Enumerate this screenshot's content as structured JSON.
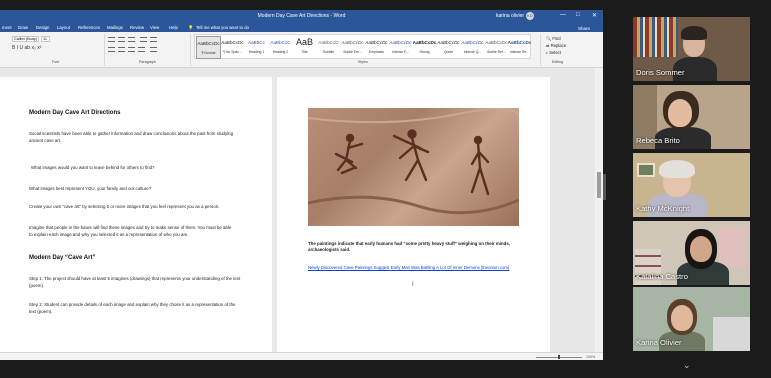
{
  "word": {
    "title": "Modern Day Cave Art Directions - Word",
    "user": "karina olivier",
    "user_initials": "KO",
    "window_controls": [
      "—",
      "□",
      "✕"
    ],
    "menu_tabs": [
      "ment",
      "Draw",
      "Design",
      "Layout",
      "References",
      "Mailings",
      "Review",
      "View",
      "Help"
    ],
    "tell_me": "Tell me what you want to do",
    "share": "Share",
    "font_name": "Calibri (Body)",
    "font_size": "11",
    "format_row": "B  I  U  ab  x₂  x²",
    "groups": {
      "font": "Font",
      "paragraph": "Paragraph",
      "styles": "Styles",
      "editing": "Editing"
    },
    "styles": [
      {
        "preview": "AaBbCcDc",
        "name": "¶ Normal"
      },
      {
        "preview": "AaBbCcDc",
        "name": "¶ No Spac..."
      },
      {
        "preview": "AaBbCc",
        "name": "Heading 1"
      },
      {
        "preview": "AaBbCcC",
        "name": "Heading 2"
      },
      {
        "preview": "AaB",
        "name": "Title"
      },
      {
        "preview": "AaBbCcD",
        "name": "Subtitle"
      },
      {
        "preview": "AaBbCcDc",
        "name": "Subtle Em..."
      },
      {
        "preview": "AaBbCcDc",
        "name": "Emphasis"
      },
      {
        "preview": "AaBbCcDc",
        "name": "Intense E..."
      },
      {
        "preview": "AaBbCcDc",
        "name": "Strong"
      },
      {
        "preview": "AaBbCcDc",
        "name": "Quote"
      },
      {
        "preview": "AaBbCcDc",
        "name": "Intense Q..."
      },
      {
        "preview": "AaBbCcDc",
        "name": "Subtle Ref..."
      },
      {
        "preview": "AaBbCcDc",
        "name": "Intense Re..."
      }
    ],
    "editing": [
      "Find",
      "Replace",
      "Select"
    ],
    "page1": {
      "heading1": "Modern Day Cave Art Directions",
      "p1": "Social scientists have been able to gather information and draw conclusions about the past from studying ancient cave art.",
      "p2": "What images would you want to leave behind for others to find?",
      "p3": "What images best represent YOU, your family and our culture?",
      "p4": "Create your own “cave art” by selecting 5 or more images that you feel represent you as a person.",
      "p5": "Imagine that people in the future will find these images and try to make sense of them. You must be able to explain each image and why you selected it as a representation of who you are.",
      "heading2": "Modern Day “Cave Art”",
      "p6": "Step 1: The project should have at least 5 imagines (drawings) that represents your understanding of the text (poem).",
      "p7": "Step 2: Student can provide details of each image and explain why they chose it as a representation of the text (poem)."
    },
    "page2": {
      "caption": "The paintings indicate that early humans had “some pretty heavy stuff” weighing on their minds, archaeologists said.",
      "link": "Newly Discovered Cave Paintings Suggest Early Man Was Battling A Lot Of Inner Demons [theonion.com]"
    },
    "zoom": "100%"
  },
  "participants": [
    {
      "name": "Doris Sommer",
      "bg": "#6e5a47",
      "skin": "#d8b49a",
      "shirt": "#2a2a2a",
      "hair": "#2b2320"
    },
    {
      "name": "Rebeca Brito",
      "bg": "#b8a48a",
      "skin": "#e3bca0",
      "shirt": "#2b2b2b",
      "hair": "#3a2a20"
    },
    {
      "name": "Kathy McKnight",
      "bg": "#c8b58f",
      "skin": "#e6c3ad",
      "shirt": "#b8b7c8",
      "hair": "#e3e0db"
    },
    {
      "name": "Katalina Castro",
      "bg": "#cfc6b8",
      "skin": "#d1a68b",
      "shirt": "#2f3a3a",
      "hair": "#1a1512"
    },
    {
      "name": "Karina Olivier",
      "bg": "#a7b5a4",
      "skin": "#e0b89c",
      "shirt": "#6f7860",
      "hair": "#5a3f2a"
    }
  ],
  "active_speaker": "Karina Olivier"
}
